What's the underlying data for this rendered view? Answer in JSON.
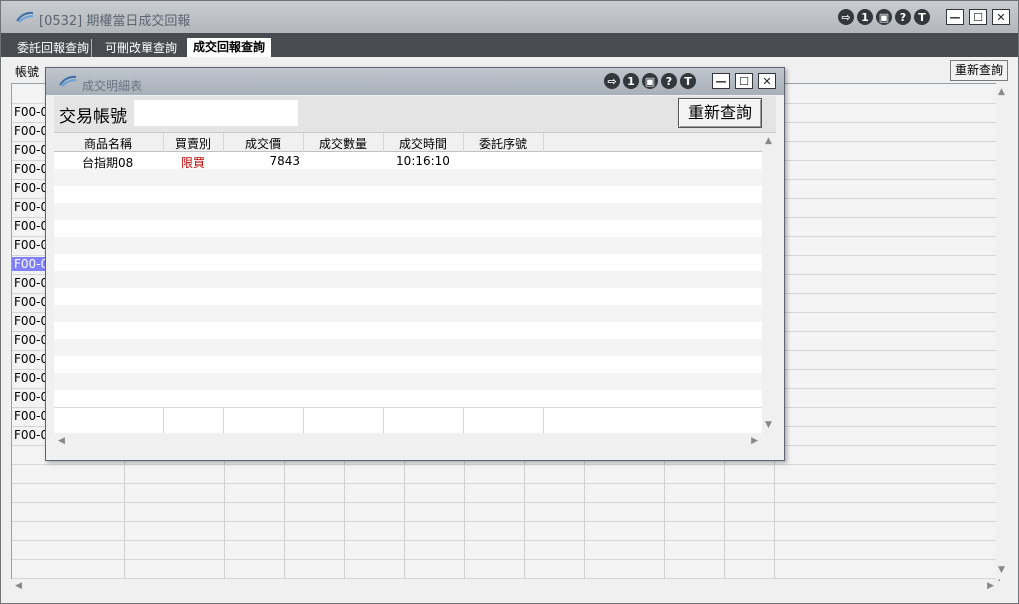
{
  "window": {
    "title": "[0532] 期權當日成交回報",
    "title_icons": [
      "exit-icon",
      "one-icon",
      "printer-icon",
      "help-icon",
      "text-icon"
    ],
    "title_icon_glyphs": [
      "⇨",
      "1",
      "▣",
      "?",
      "T"
    ],
    "window_buttons": [
      "—",
      "☐",
      "✕"
    ]
  },
  "tabs": [
    {
      "label": "委託回報查詢"
    },
    {
      "label": "可刪改單查詢"
    },
    {
      "label": "成交回報查詢"
    }
  ],
  "toolbar": {
    "account_label": "帳號",
    "requery_label": "重新查詢"
  },
  "main_grid": {
    "rows": [
      "",
      "F00-0",
      "F00-0",
      "F00-0",
      "F00-0",
      "F00-0",
      "F00-0",
      "F00-0",
      "F00-0",
      "F00-0",
      "F00-0",
      "F00-0",
      "F00-0",
      "F00-0",
      "F00-0",
      "F00-0",
      "F00-0",
      "F00-0",
      "F00-0",
      "",
      "",
      "",
      "",
      "",
      "",
      ""
    ],
    "selected_row": 9
  },
  "dialog": {
    "title": "成交明細表",
    "account_label": "交易帳號",
    "account_value": "",
    "requery_label": "重新查詢",
    "columns": [
      "商品名稱",
      "買賣別",
      "成交價",
      "成交數量",
      "成交時間",
      "委託序號"
    ],
    "rows": [
      {
        "product": "台指期08",
        "side": "限買",
        "price": "7843",
        "qty": "",
        "time": "10:16:10",
        "order_no": ""
      }
    ],
    "side_color": "#c00000"
  }
}
